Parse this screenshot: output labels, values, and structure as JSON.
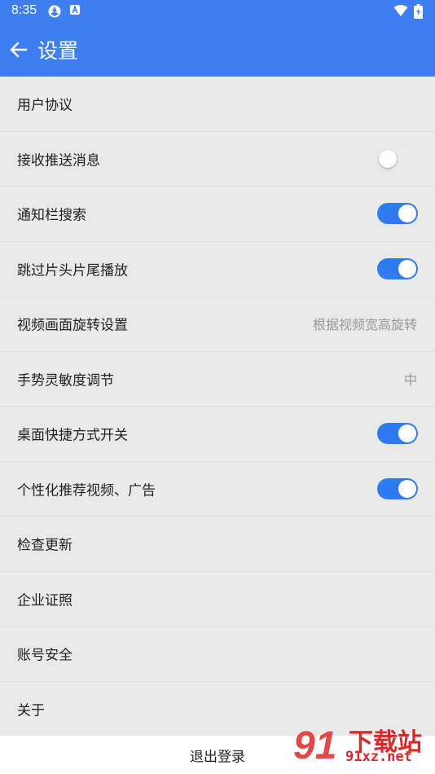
{
  "status_bar": {
    "time": "8:35"
  },
  "app_bar": {
    "title": "设置"
  },
  "rows": [
    {
      "label": "用户协议"
    },
    {
      "label": "接收推送消息",
      "toggle": "off"
    },
    {
      "label": "通知栏搜索",
      "toggle": "on"
    },
    {
      "label": "跳过片头片尾播放",
      "toggle": "on"
    },
    {
      "label": "视频画面旋转设置",
      "value": "根据视频宽高旋转"
    },
    {
      "label": "手势灵敏度调节",
      "value": "中"
    },
    {
      "label": "桌面快捷方式开关",
      "toggle": "on"
    },
    {
      "label": "个性化推荐视频、广告",
      "toggle": "on"
    },
    {
      "label": "检查更新"
    },
    {
      "label": "企业证照"
    },
    {
      "label": "账号安全"
    },
    {
      "label": "关于"
    }
  ],
  "logout": {
    "label": "退出登录"
  },
  "watermark": {
    "logo": "91",
    "top": "下载站",
    "bottom": "91xz.net"
  },
  "colors": {
    "accent": "#3d7ff0",
    "toggle_on": "#2f7cf0"
  }
}
